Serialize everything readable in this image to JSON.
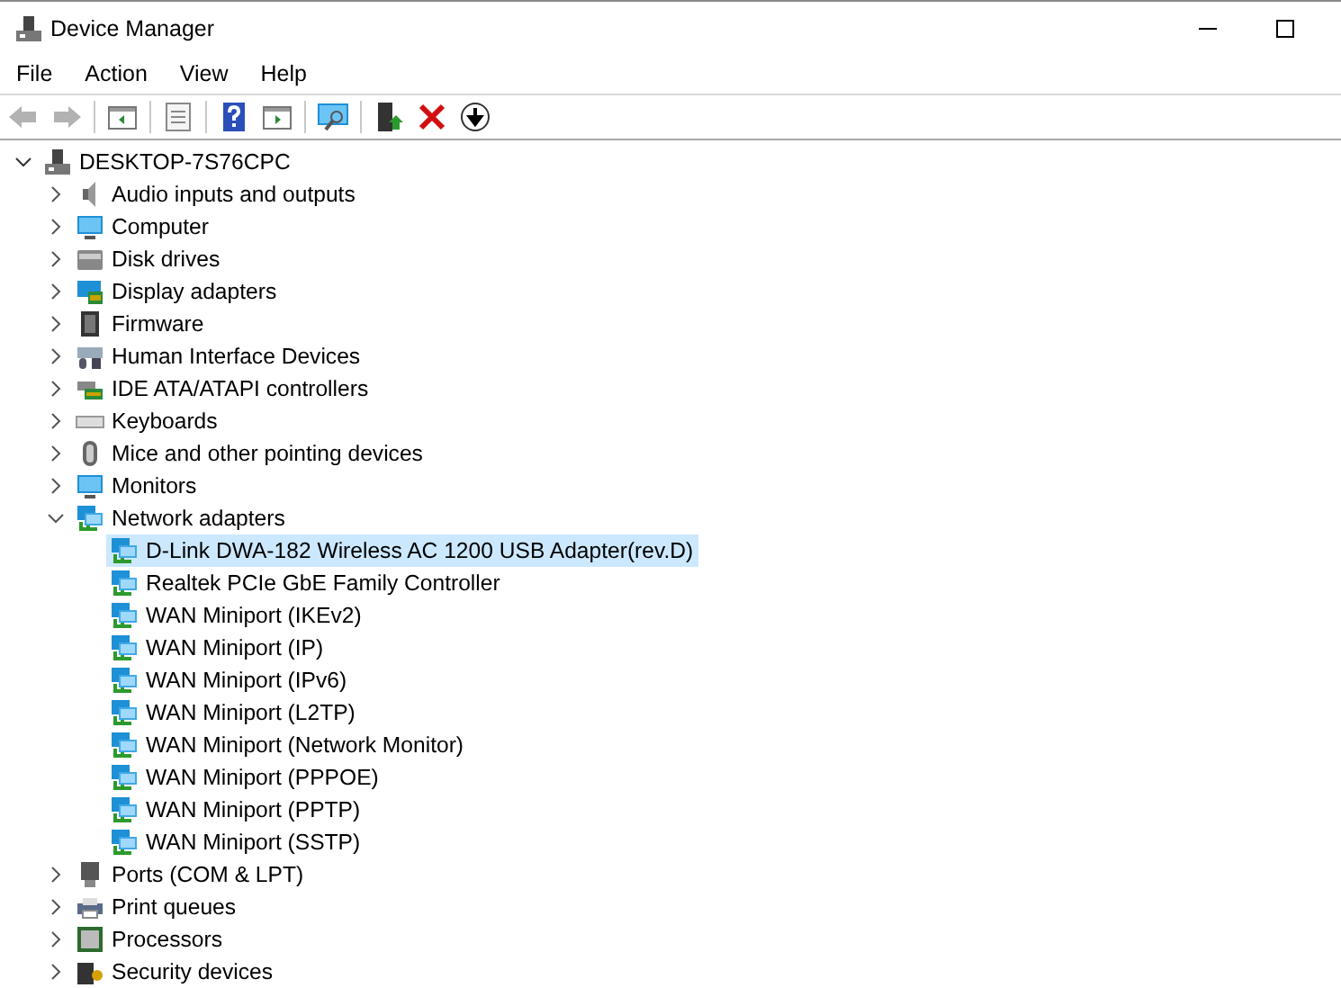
{
  "window": {
    "title": "Device Manager"
  },
  "menu": [
    "File",
    "Action",
    "View",
    "Help"
  ],
  "toolbar": [
    {
      "kind": "back",
      "disabled": true
    },
    {
      "kind": "forward",
      "disabled": true
    },
    {
      "kind": "console-tree"
    },
    {
      "kind": "properties"
    },
    {
      "kind": "help"
    },
    {
      "kind": "action-pane"
    },
    {
      "kind": "scan"
    },
    {
      "kind": "update"
    },
    {
      "kind": "uninstall"
    },
    {
      "kind": "disable"
    }
  ],
  "tree": {
    "label": "DESKTOP-7S76CPC",
    "kind": "computer-root",
    "expanded": true,
    "selected": false,
    "children": [
      {
        "label": "Audio inputs and outputs",
        "kind": "audio",
        "expanded": false,
        "selected": false
      },
      {
        "label": "Computer",
        "kind": "monitor",
        "expanded": false,
        "selected": false
      },
      {
        "label": "Disk drives",
        "kind": "disk",
        "expanded": false,
        "selected": false
      },
      {
        "label": "Display adapters",
        "kind": "display",
        "expanded": false,
        "selected": false
      },
      {
        "label": "Firmware",
        "kind": "chip",
        "expanded": false,
        "selected": false
      },
      {
        "label": "Human Interface Devices",
        "kind": "hid",
        "expanded": false,
        "selected": false
      },
      {
        "label": "IDE ATA/ATAPI controllers",
        "kind": "ide",
        "expanded": false,
        "selected": false
      },
      {
        "label": "Keyboards",
        "kind": "keyboard",
        "expanded": false,
        "selected": false
      },
      {
        "label": "Mice and other pointing devices",
        "kind": "mouse",
        "expanded": false,
        "selected": false
      },
      {
        "label": "Monitors",
        "kind": "monitor",
        "expanded": false,
        "selected": false
      },
      {
        "label": "Network adapters",
        "kind": "network",
        "expanded": true,
        "selected": false,
        "children": [
          {
            "label": "D-Link DWA-182 Wireless AC 1200 USB Adapter(rev.D)",
            "kind": "network",
            "selected": true
          },
          {
            "label": "Realtek PCIe GbE Family Controller",
            "kind": "network",
            "selected": false
          },
          {
            "label": "WAN Miniport (IKEv2)",
            "kind": "network",
            "selected": false
          },
          {
            "label": "WAN Miniport (IP)",
            "kind": "network",
            "selected": false
          },
          {
            "label": "WAN Miniport (IPv6)",
            "kind": "network",
            "selected": false
          },
          {
            "label": "WAN Miniport (L2TP)",
            "kind": "network",
            "selected": false
          },
          {
            "label": "WAN Miniport (Network Monitor)",
            "kind": "network",
            "selected": false
          },
          {
            "label": "WAN Miniport (PPPOE)",
            "kind": "network",
            "selected": false
          },
          {
            "label": "WAN Miniport (PPTP)",
            "kind": "network",
            "selected": false
          },
          {
            "label": "WAN Miniport (SSTP)",
            "kind": "network",
            "selected": false
          }
        ]
      },
      {
        "label": "Ports (COM & LPT)",
        "kind": "port",
        "expanded": false,
        "selected": false
      },
      {
        "label": "Print queues",
        "kind": "printer",
        "expanded": false,
        "selected": false
      },
      {
        "label": "Processors",
        "kind": "processor",
        "expanded": false,
        "selected": false
      },
      {
        "label": "Security devices",
        "kind": "security",
        "expanded": false,
        "selected": false
      }
    ]
  }
}
